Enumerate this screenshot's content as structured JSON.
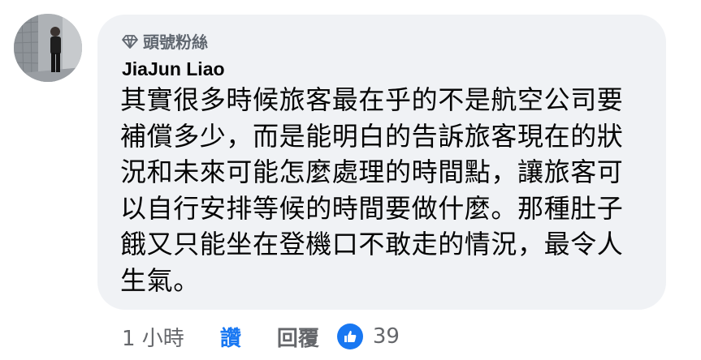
{
  "comment": {
    "badge_label": "頭號粉絲",
    "author": "JiaJun Liao",
    "text": "其實很多時候旅客最在乎的不是航空公司要\n補償多少，而是能明白的告訴旅客現在的狀\n況和未來可能怎麼處理的時間點，讓旅客可\n以自行安排等候的時間要做什麼。那種肚子\n餓又只能坐在登機口不敢走的情況，最令人\n生氣。"
  },
  "actions": {
    "time": "1 小時",
    "like_label": "讚",
    "reply_label": "回覆",
    "reaction_count": "39"
  },
  "colors": {
    "bubble_bg": "#f0f2f5",
    "accent": "#1877f2",
    "secondary_text": "#65676b"
  }
}
